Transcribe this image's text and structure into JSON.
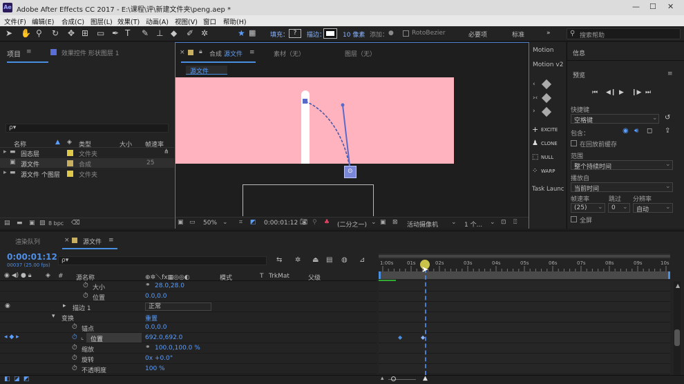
{
  "titlebar": {
    "logo": "Ae",
    "title": "Adobe After Effects CC 2017 - E:\\课程\\评\\新建文件夹\\peng.aep *",
    "buttons": [
      "—",
      "☐",
      "✕"
    ]
  },
  "menu": [
    "文件(F)",
    "编辑(E)",
    "合成(C)",
    "图层(L)",
    "效果(T)",
    "动画(A)",
    "视图(V)",
    "窗口",
    "帮助(H)"
  ],
  "toolbar": {
    "fill_label": "填充：",
    "fill_value": "?",
    "stroke_label": "描边：",
    "stroke_width": "10 像素",
    "add_label": "添加：",
    "rotobezier": "RotoBezier",
    "workspace": "必要项",
    "workspace2": "标准",
    "search_placeholder": "搜索帮助"
  },
  "project": {
    "tab_label": "项目",
    "effect_tab": "效果控件 形状图层 1",
    "search_placeholder": "ρ▾",
    "col_name": "名称",
    "col_type": "类型",
    "col_size": "大小",
    "col_fps": "帧速率",
    "items": [
      {
        "name": "固态层",
        "color": "#e0c84a",
        "type": "文件夹",
        "size": "",
        "fps": ""
      },
      {
        "name": "源文件",
        "color": "#c8b060",
        "type": "合成",
        "size": "",
        "fps": "25"
      },
      {
        "name": "源文件 个图层",
        "color": "#e0c84a",
        "type": "文件夹",
        "size": "",
        "fps": ""
      }
    ],
    "bpc": "8 bpc"
  },
  "comp": {
    "close": "×",
    "tab_label": "合成",
    "comp_name": "源文件",
    "footage_tab": "素材（无）",
    "layer_tab": "图层（无）",
    "breadcrumb": "源文件",
    "zoom": "50%",
    "timecode": "0:00:01:12",
    "resolution": "(二分之一)",
    "camera": "活动摄像机",
    "views": "1 个...",
    "canvas_color": "#ffb3bf"
  },
  "motion": {
    "title": "Motion",
    "subtitle": "Motion v2",
    "excite": "EXCITE",
    "clone": "CLONE",
    "null": "NULL",
    "warp": "WARP",
    "task": "Task Launc"
  },
  "preview": {
    "info_tab": "信息",
    "preview_tab": "预览",
    "shortcut_label": "快捷键",
    "shortcut_value": "空格键",
    "include_label": "包含：",
    "cache_label": "在回放前缓存",
    "range_label": "范围",
    "range_value": "整个持续时间",
    "play_from_label": "播放自",
    "play_from_value": "当前时间",
    "fps_label": "帧速率",
    "skip_label": "跳过",
    "res_label": "分辨率",
    "fps_value": "(25)",
    "skip_value": "0",
    "res_value": "自动",
    "fullscreen_label": "全屏"
  },
  "timeline": {
    "render_tab": "渲染队列",
    "comp_tab": "源文件",
    "close": "×",
    "timecode": "0:00:01:12",
    "subtime": "00037 (25.00 fps)",
    "search_placeholder": "ρ▾",
    "col_source": "源名称",
    "col_mode": "模式",
    "col_t": "T",
    "col_trkmat": "TrkMat",
    "col_parent": "父级",
    "rows": [
      {
        "label": "大小",
        "value": "28.0,28.0",
        "indent": 120
      },
      {
        "label": "位置",
        "value": "0.0,0.0",
        "indent": 120
      },
      {
        "label": "描边 1",
        "value": "正常",
        "indent": 104
      },
      {
        "label": "变换",
        "value": "重置",
        "indent": 88
      },
      {
        "label": "锚点",
        "value": "0.0,0.0",
        "indent": 104
      },
      {
        "label": "位置",
        "value": "692.0,692.0",
        "indent": 104
      },
      {
        "label": "缩放",
        "value": "100.0,100.0 %",
        "indent": 104
      },
      {
        "label": "旋转",
        "value": "0x +0.0°",
        "indent": 104
      },
      {
        "label": "不透明度",
        "value": "100 %",
        "indent": 104
      }
    ],
    "ruler": [
      "1:00s",
      "01s",
      "02s",
      "03s",
      "04s",
      "05s",
      "06s",
      "07s",
      "08s",
      "09s",
      "10s"
    ],
    "playhead_sec": 1.48
  }
}
